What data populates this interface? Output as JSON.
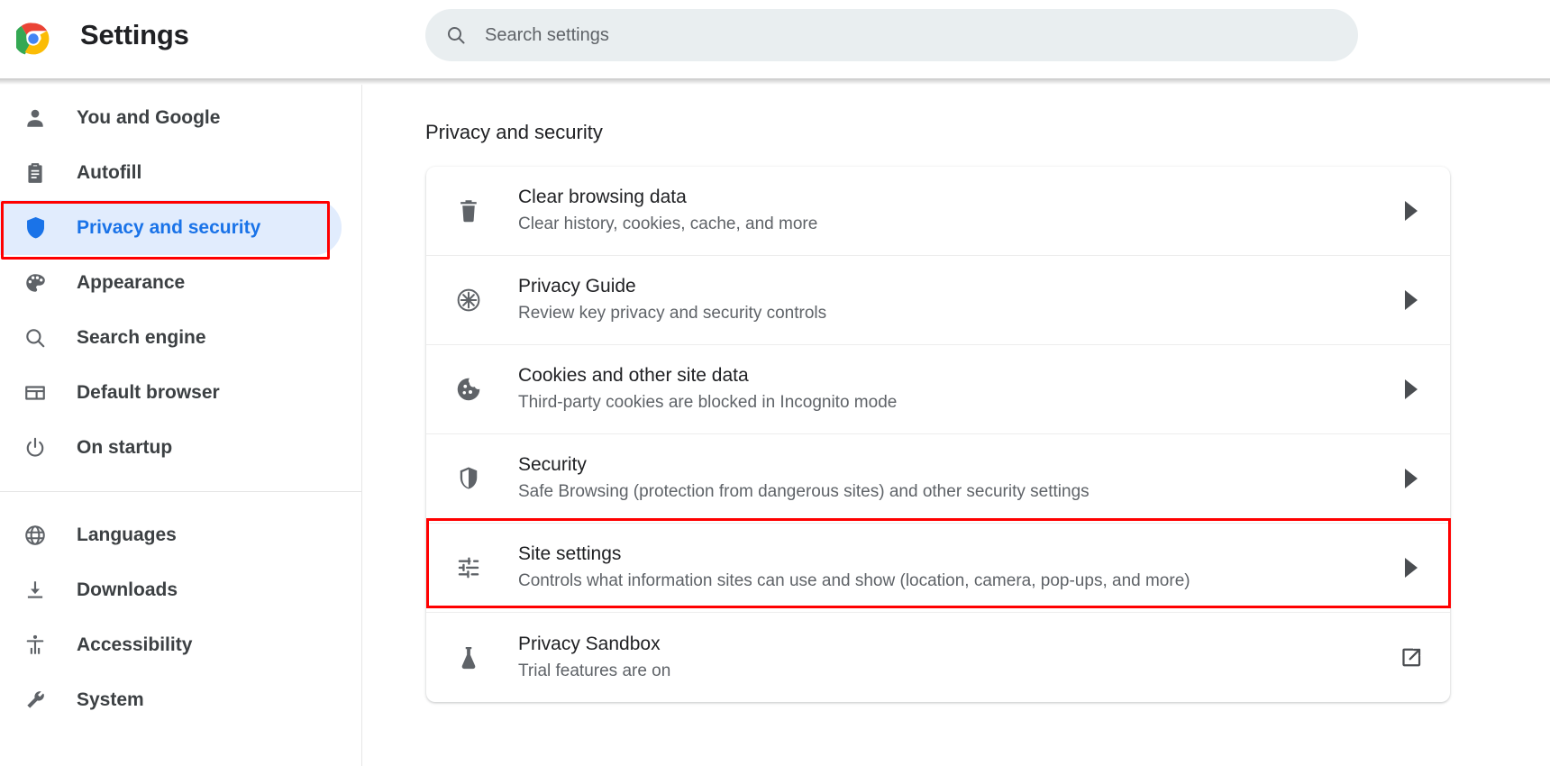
{
  "header": {
    "logo_icon": "chrome-logo-icon",
    "title": "Settings"
  },
  "search": {
    "icon": "search-icon",
    "placeholder": "Search settings",
    "value": ""
  },
  "sidebar": {
    "groups": [
      {
        "items": [
          {
            "icon": "person-icon",
            "label": "You and Google",
            "active": false
          },
          {
            "icon": "clipboard-icon",
            "label": "Autofill",
            "active": false
          },
          {
            "icon": "shield-icon",
            "label": "Privacy and security",
            "active": true
          },
          {
            "icon": "palette-icon",
            "label": "Appearance",
            "active": false
          },
          {
            "icon": "search-icon",
            "label": "Search engine",
            "active": false
          },
          {
            "icon": "browser-window-icon",
            "label": "Default browser",
            "active": false
          },
          {
            "icon": "power-icon",
            "label": "On startup",
            "active": false
          }
        ]
      },
      {
        "items": [
          {
            "icon": "globe-icon",
            "label": "Languages",
            "active": false
          },
          {
            "icon": "download-icon",
            "label": "Downloads",
            "active": false
          },
          {
            "icon": "accessibility-icon",
            "label": "Accessibility",
            "active": false
          },
          {
            "icon": "wrench-icon",
            "label": "System",
            "active": false
          }
        ]
      }
    ]
  },
  "main": {
    "section_title": "Privacy and security",
    "rows": [
      {
        "icon": "trash-icon",
        "title": "Clear browsing data",
        "subtitle": "Clear history, cookies, cache, and more",
        "end_icon": "arrow-right-icon"
      },
      {
        "icon": "privacy-guide-icon",
        "title": "Privacy Guide",
        "subtitle": "Review key privacy and security controls",
        "end_icon": "arrow-right-icon"
      },
      {
        "icon": "cookie-icon",
        "title": "Cookies and other site data",
        "subtitle": "Third-party cookies are blocked in Incognito mode",
        "end_icon": "arrow-right-icon"
      },
      {
        "icon": "shield-icon",
        "title": "Security",
        "subtitle": "Safe Browsing (protection from dangerous sites) and other security settings",
        "end_icon": "arrow-right-icon"
      },
      {
        "icon": "tune-sliders-icon",
        "title": "Site settings",
        "subtitle": "Controls what information sites can use and show (location, camera, pop-ups, and more)",
        "end_icon": "arrow-right-icon"
      },
      {
        "icon": "flask-icon",
        "title": "Privacy Sandbox",
        "subtitle": "Trial features are on",
        "end_icon": "open-in-new-icon"
      }
    ]
  },
  "annotations": {
    "color": "#ff0000",
    "targets": [
      "sidebar-item-privacy-and-security",
      "row-site-settings"
    ]
  },
  "colors": {
    "accent": "#1a73e8",
    "accent_bg": "#e1ecfd",
    "text_primary": "#202124",
    "text_secondary": "#5f6368",
    "search_bg": "#e9eef0",
    "annotation": "#ff0000"
  }
}
